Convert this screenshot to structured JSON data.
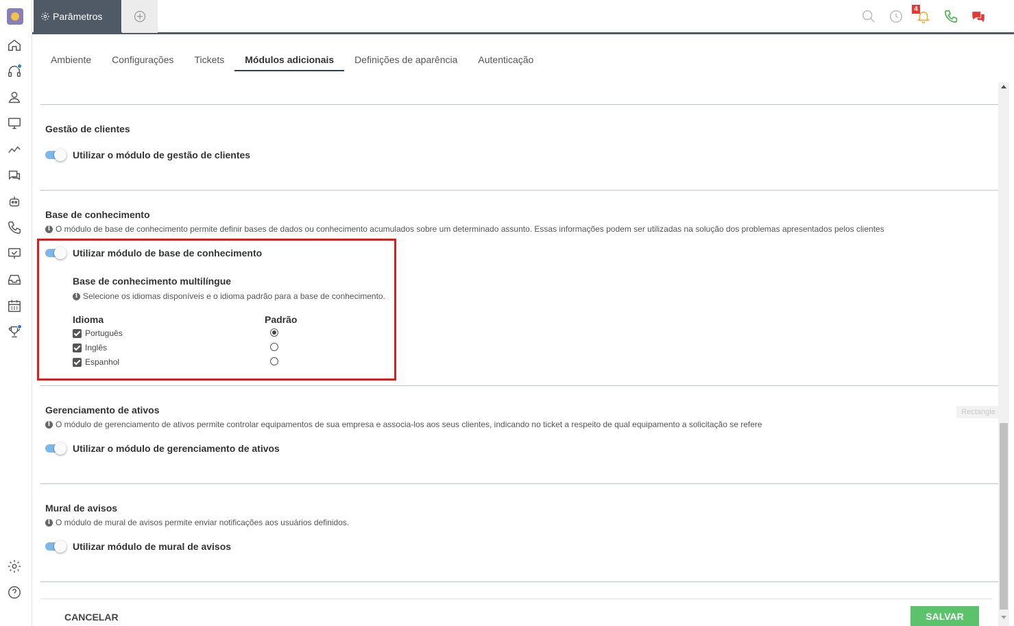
{
  "app": {
    "active_tab": "Parâmetros",
    "notification_count": "4"
  },
  "sidebar": {
    "icons": [
      "home-icon",
      "headset-icon",
      "contacts-icon",
      "monitor-icon",
      "chart-icon",
      "chat-icon",
      "robot-icon",
      "phone-icon",
      "presentation-icon",
      "inbox-icon",
      "calendar-icon",
      "trophy-icon",
      "settings-icon",
      "help-icon"
    ]
  },
  "topbar": {
    "icons": [
      "search-icon",
      "history-icon",
      "bell-icon",
      "phone-icon",
      "chat-bubbles-icon"
    ],
    "colors": {
      "bar": "#4f5a66",
      "bell": "#f5a623",
      "phone": "#4caf50",
      "chat": "#e53935"
    }
  },
  "subtabs": [
    "Ambiente",
    "Configurações",
    "Tickets",
    "Módulos adicionais",
    "Definições de aparência",
    "Autenticação"
  ],
  "sections": {
    "clients": {
      "title": "Gestão de clientes",
      "toggle_label": "Utilizar o módulo de gestão de clientes",
      "enabled": true
    },
    "kb": {
      "title": "Base de conhecimento",
      "info": "O módulo de base de conhecimento permite definir bases de dados ou conhecimento acumulados sobre um determinado assunto. Essas informações podem ser utilizadas na solução dos problemas apresentados pelos clientes",
      "toggle_label": "Utilizar módulo de base de conhecimento",
      "enabled": true,
      "multi_title": "Base de conhecimento multilíngue",
      "multi_info": "Selecione os idiomas disponíveis e o idioma padrão para a base de conhecimento.",
      "col_language": "Idioma",
      "col_default": "Padrão",
      "languages": [
        {
          "name": "Português",
          "checked": true,
          "default": true
        },
        {
          "name": "Inglês",
          "checked": true,
          "default": false
        },
        {
          "name": "Espanhol",
          "checked": true,
          "default": false
        }
      ]
    },
    "assets": {
      "title": "Gerenciamento de ativos",
      "info": "O módulo de gerenciamento de ativos permite controlar equipamentos de sua empresa e associa-los aos seus clientes, indicando no ticket a respeito de qual equipamento a solicitação se refere",
      "toggle_label": "Utilizar o módulo de gerenciamento de ativos",
      "enabled": true
    },
    "notices": {
      "title": "Mural de avisos",
      "info": "O módulo de mural de avisos permite enviar notificações aos usuários definidos.",
      "toggle_label": "Utilizar módulo de mural de avisos",
      "enabled": true
    }
  },
  "overlay_label": "Rectangle",
  "footer": {
    "cancel": "CANCELAR",
    "save": "SALVAR"
  }
}
